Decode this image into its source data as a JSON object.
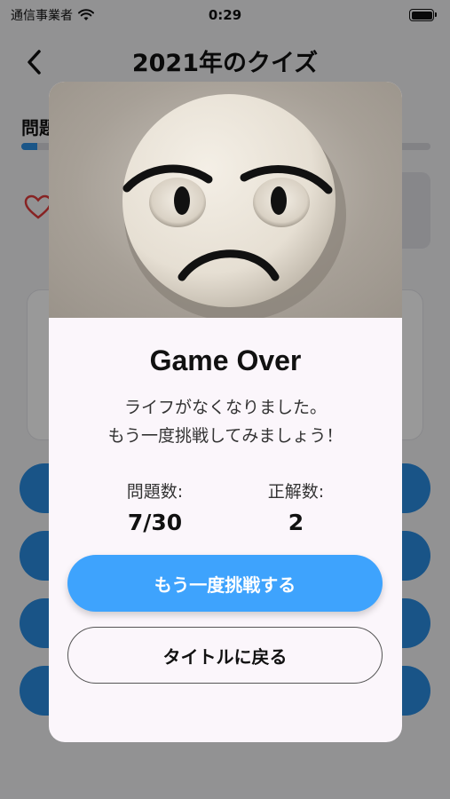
{
  "status_bar": {
    "carrier": "通信事業者",
    "time": "0:29"
  },
  "nav": {
    "title": "2021年のクイズ",
    "back_icon": "chevron-left-icon"
  },
  "background": {
    "tab_label": "問題",
    "progress": 0.04,
    "heart_icon": "heart-outline-icon"
  },
  "modal": {
    "image_icon": "frowning-face-icon",
    "title": "Game Over",
    "message_line1": "ライフがなくなりました。",
    "message_line2": "もう一度挑戦してみましょう！",
    "stats": {
      "questions_label": "問題数:",
      "questions_value": "7/30",
      "correct_label": "正解数:",
      "correct_value": "2"
    },
    "retry_button": "もう一度挑戦する",
    "title_button": "タイトルに戻る"
  },
  "colors": {
    "accent": "#3ea3fd",
    "overlay": "rgba(0,0,0,0.40)",
    "heart": "#e23b3b"
  }
}
